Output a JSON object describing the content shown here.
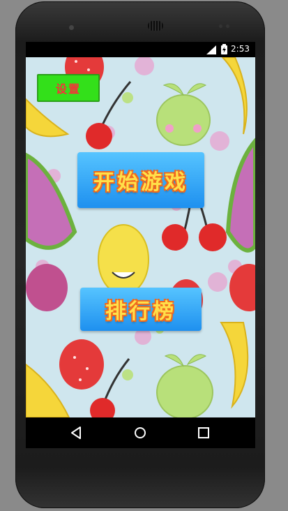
{
  "status_bar": {
    "time": "2:53"
  },
  "app": {
    "settings_label": "设置",
    "start_game_label": "开始游戏",
    "leaderboard_label": "排行榜"
  },
  "nav_bar": {
    "back": "back-icon",
    "home": "home-icon",
    "recents": "recents-icon"
  },
  "colors": {
    "accent_green": "#33e01a",
    "button_blue": "#2196f3",
    "label_red": "#ff2a3a",
    "label_yellow": "#ffe04a"
  }
}
